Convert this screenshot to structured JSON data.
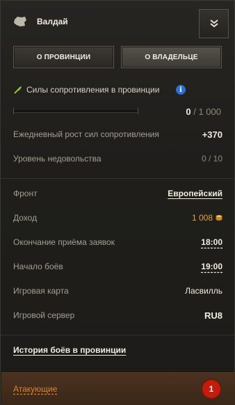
{
  "header": {
    "province_name": "Валдай",
    "province_icon": "map-region-icon",
    "collapse_icon": "double-chevron-down-icon"
  },
  "tabs": [
    {
      "label": "О ПРОВИНЦИИ",
      "active": false
    },
    {
      "label": "О ВЛАДЕЛЬЦЕ",
      "active": true
    }
  ],
  "resistance": {
    "title": "Силы сопротивления в провинции",
    "info_icon": "i",
    "current": "0",
    "max": "/ 1 000",
    "progress_fraction": 0
  },
  "stats": [
    {
      "label": "Ежедневный рост сил сопротивления",
      "value": "+370"
    },
    {
      "label": "Уровень недовольства",
      "value": "0 / 10"
    }
  ],
  "details": [
    {
      "label": "Фронт",
      "value": "Европейский"
    },
    {
      "label": "Доход",
      "value": "1 008"
    },
    {
      "label": "Окончание приёма заявок",
      "value": "18:00"
    },
    {
      "label": "Начало боёв",
      "value": "19:00"
    },
    {
      "label": "Игровая карта",
      "value": "Ласвилль"
    },
    {
      "label": "Игровой сервер",
      "value": "RU8"
    }
  ],
  "history_link": "История боёв в провинции",
  "attackers": {
    "label": "Атакующие",
    "count": "1"
  },
  "colors": {
    "accent_gold": "#e8a235",
    "progress_green": "#8aa83a",
    "info_blue": "#2d6fd3",
    "badge_red": "#c61a0a",
    "attackers_orange": "#e0832c"
  }
}
